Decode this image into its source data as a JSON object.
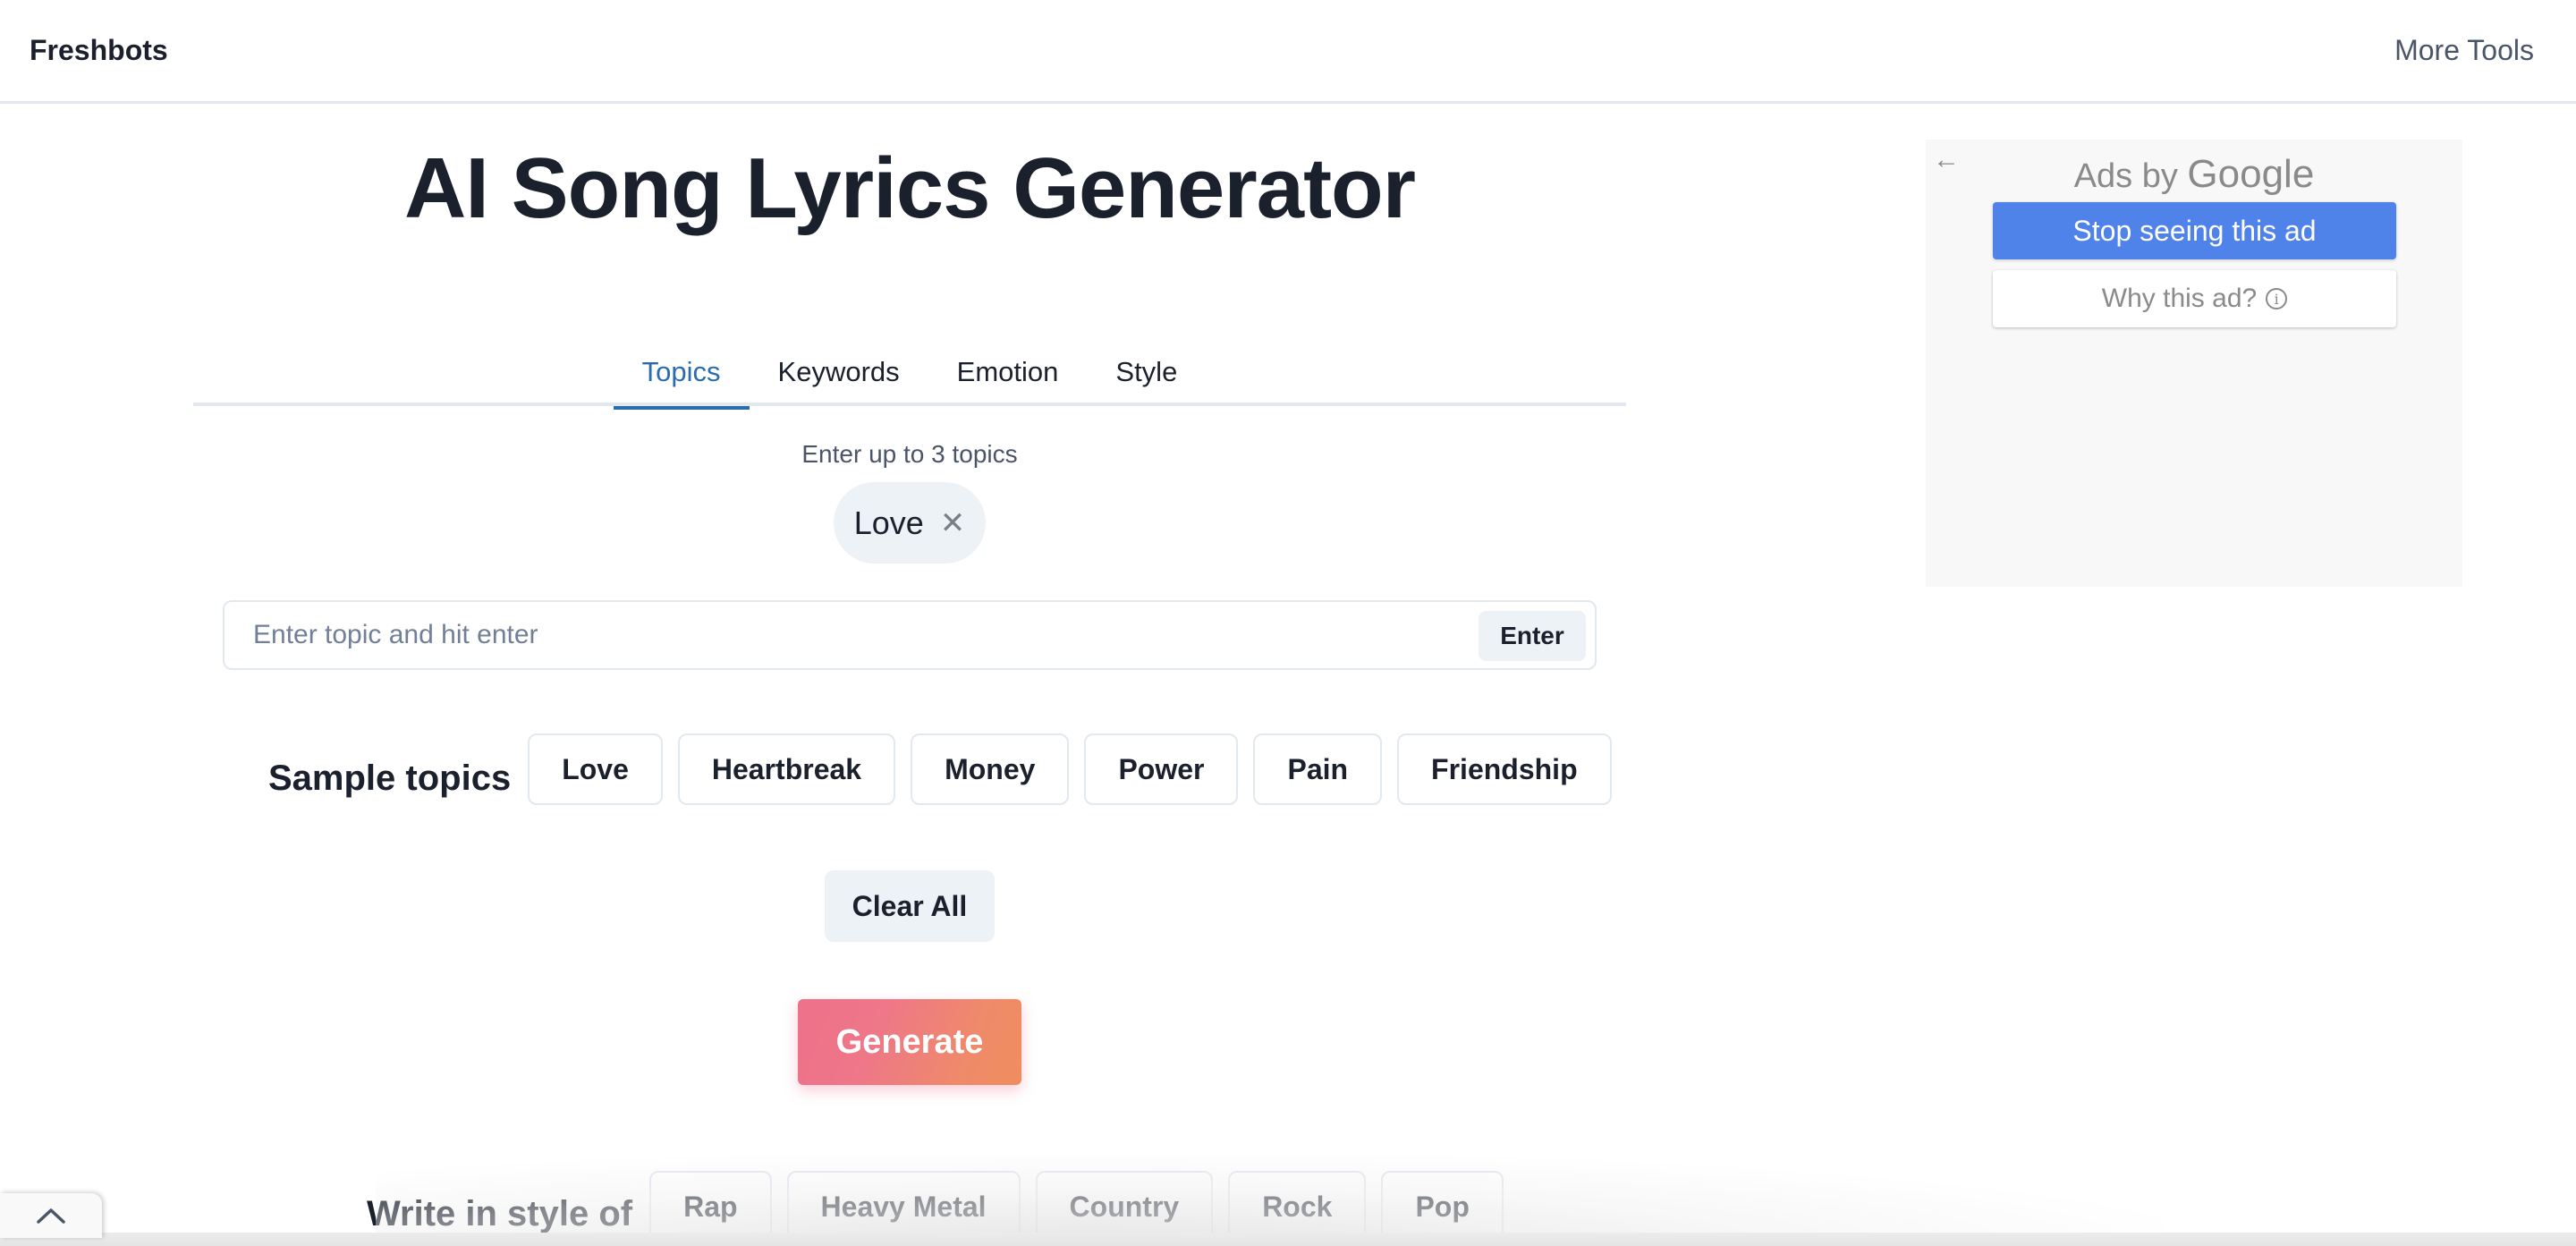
{
  "nav": {
    "brand": "Freshbots",
    "more_tools": "More Tools"
  },
  "page": {
    "title": "AI Song Lyrics Generator"
  },
  "tabs": [
    {
      "label": "Topics",
      "active": true
    },
    {
      "label": "Keywords",
      "active": false
    },
    {
      "label": "Emotion",
      "active": false
    },
    {
      "label": "Style",
      "active": false
    }
  ],
  "topics": {
    "hint": "Enter up to 3 topics",
    "selected": [
      {
        "label": "Love",
        "remove_icon": "close-icon"
      }
    ],
    "input": {
      "value": "",
      "placeholder": "Enter topic and hit enter",
      "enter_label": "Enter"
    },
    "sample_label": "Sample topics",
    "samples": [
      "Love",
      "Heartbreak",
      "Money",
      "Power",
      "Pain",
      "Friendship"
    ],
    "clear_label": "Clear All"
  },
  "generate": {
    "label": "Generate",
    "gradient_start": "#ed718b",
    "gradient_end": "#f08d5f"
  },
  "style": {
    "label": "Write in style of",
    "options": [
      "Rap",
      "Heavy Metal",
      "Country",
      "Rock",
      "Pop"
    ]
  },
  "ad": {
    "back_icon": "arrow-left-icon",
    "ads_by": "Ads by",
    "google": "Google",
    "stop_label": "Stop seeing this ad",
    "why_label": "Why this ad?",
    "info_icon": "info-icon",
    "accent": "#5083ea"
  },
  "scroll_top": {
    "icon": "chevron-up-icon"
  },
  "colors": {
    "active_tab": "#2b6cb0",
    "text": "#1a202c",
    "chip_bg": "#edf2f7"
  }
}
